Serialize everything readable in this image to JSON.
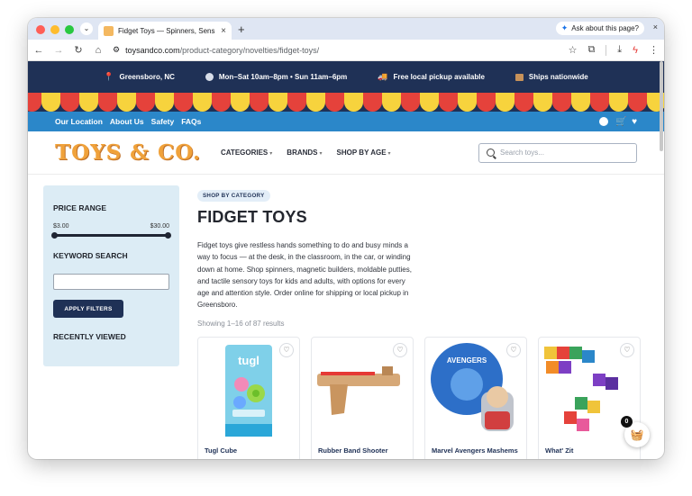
{
  "browser": {
    "tab_title": "Fidget Toys — Spinners, Sens",
    "tab_close": "×",
    "new_tab": "+",
    "ask_label": "Ask about this page?",
    "window_close": "×",
    "url_host": "toysandco.com",
    "url_path": "/product-category/novelties/fidget-toys/"
  },
  "infobar": {
    "location": "Greensboro, NC",
    "hours": "Mon–Sat 10am–8pm • Sun 11am–6pm",
    "pickup": "Free local pickup available",
    "shipping": "Ships nationwide"
  },
  "bluebar": {
    "links": [
      "Our Location",
      "About Us",
      "Safety",
      "FAQs"
    ]
  },
  "header": {
    "logo": "TOYS & CO.",
    "nav": [
      {
        "label": "CATEGORIES"
      },
      {
        "label": "BRANDS"
      },
      {
        "label": "SHOP BY AGE"
      }
    ],
    "search_placeholder": "Search toys..."
  },
  "sidebar": {
    "price_heading": "PRICE RANGE",
    "price_min": "$3.00",
    "price_max": "$30.00",
    "price_min_fraction": 0.0,
    "price_max_fraction": 1.0,
    "keyword_heading": "KEYWORD SEARCH",
    "apply_label": "APPLY FILTERS",
    "recent_heading": "RECENTLY VIEWED"
  },
  "main": {
    "pill": "SHOP BY CATEGORY",
    "title": "FIDGET TOYS",
    "description": "Fidget toys give restless hands something to do and busy minds a way to focus — at the desk, in the classroom, in the car, or winding down at home. Shop spinners, magnetic builders, moldable putties, and tactile sensory toys for kids and adults, with options for every age and attention style. Order online for shipping or local pickup in Greensboro.",
    "showing": "Showing 1–16 of 87 results",
    "products": [
      {
        "name": "Tugl Cube",
        "image_text": "tugl"
      },
      {
        "name": "Rubber Band Shooter"
      },
      {
        "name": "Marvel Avengers Mashems",
        "image_text": "AVENGERS"
      },
      {
        "name": "What' Zit"
      }
    ]
  },
  "cart": {
    "count": "0"
  },
  "colors": {
    "navy": "#1f3156",
    "blue": "#2b87c9",
    "yellow": "#f7d33d",
    "red": "#e5423b",
    "logo": "#f0a23b"
  }
}
